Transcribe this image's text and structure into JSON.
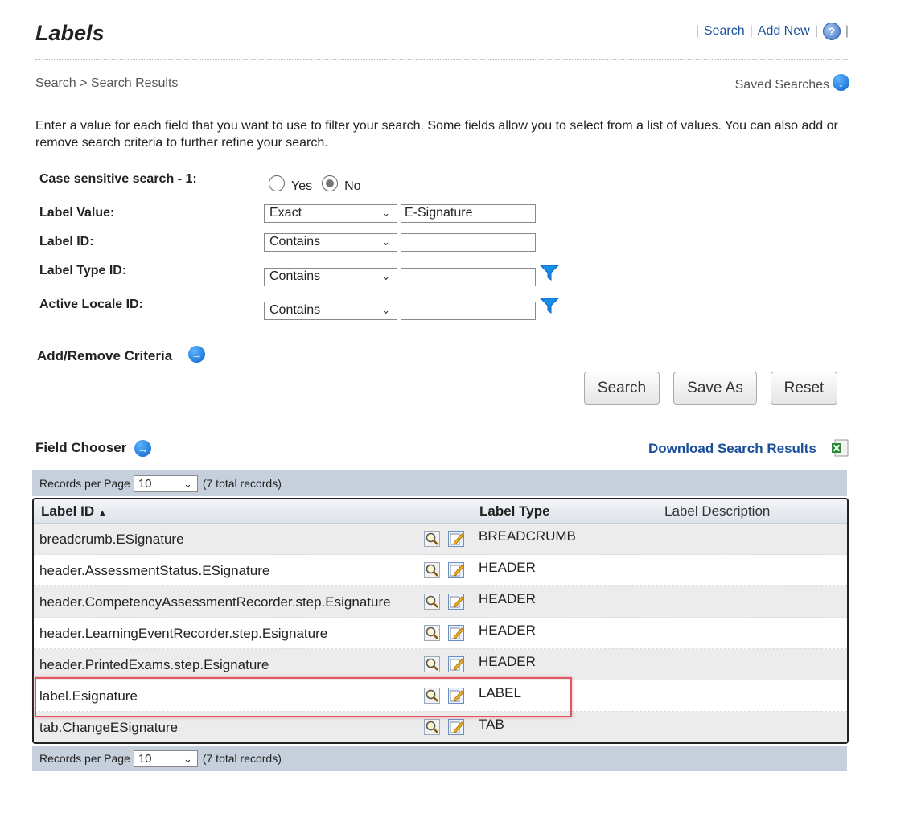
{
  "page": {
    "title": "Labels"
  },
  "top_links": {
    "search": "Search",
    "add_new": "Add New",
    "sep": "|",
    "help_glyph": "?"
  },
  "breadcrumb": {
    "text": "Search > Search Results"
  },
  "saved_searches": {
    "label": "Saved Searches"
  },
  "intro": "Enter a value for each field that you want to use to filter your search. Some fields allow you to select from a list of values. You can also add or remove search criteria to further refine your search.",
  "criteria": {
    "case_sensitive": {
      "label": "Case sensitive search - 1:",
      "yes": "Yes",
      "no": "No",
      "selected": "No"
    },
    "label_value": {
      "label": "Label Value:",
      "operator": "Exact",
      "value": "E-Signature"
    },
    "label_id": {
      "label": "Label ID:",
      "operator": "Contains",
      "value": ""
    },
    "label_type_id": {
      "label": "Label Type ID:",
      "operator": "Contains",
      "value": ""
    },
    "active_locale_id": {
      "label": "Active Locale ID:",
      "operator": "Contains",
      "value": ""
    }
  },
  "add_remove": {
    "label": "Add/Remove Criteria"
  },
  "buttons": {
    "search": "Search",
    "save_as": "Save As",
    "reset": "Reset"
  },
  "field_chooser": {
    "label": "Field Chooser"
  },
  "download": {
    "label": "Download Search Results"
  },
  "pager": {
    "label": "Records per Page",
    "value": "10",
    "total": "(7 total records)"
  },
  "grid": {
    "columns": {
      "label_id": "Label ID",
      "sort_glyph": "▲",
      "label_type": "Label Type",
      "label_description": "Label Description"
    },
    "rows": [
      {
        "id": "breadcrumb.ESignature",
        "type": "BREADCRUMB"
      },
      {
        "id": "header.AssessmentStatus.ESignature",
        "type": "HEADER"
      },
      {
        "id": "header.CompetencyAssessmentRecorder.step.Esignature",
        "type": "HEADER"
      },
      {
        "id": "header.LearningEventRecorder.step.Esignature",
        "type": "HEADER"
      },
      {
        "id": "header.PrintedExams.step.Esignature",
        "type": "HEADER"
      },
      {
        "id": "label.Esignature",
        "type": "LABEL"
      },
      {
        "id": "tab.ChangeESignature",
        "type": "TAB"
      }
    ],
    "highlighted_row": 5,
    "row_icons": [
      "view-magnifier-icon",
      "edit-pencil-icon"
    ]
  },
  "colors": {
    "link": "#1a4f9c",
    "accent_blue": "#0a62c8",
    "highlight": "#e05560",
    "pager_bg": "#c6d0dd"
  }
}
